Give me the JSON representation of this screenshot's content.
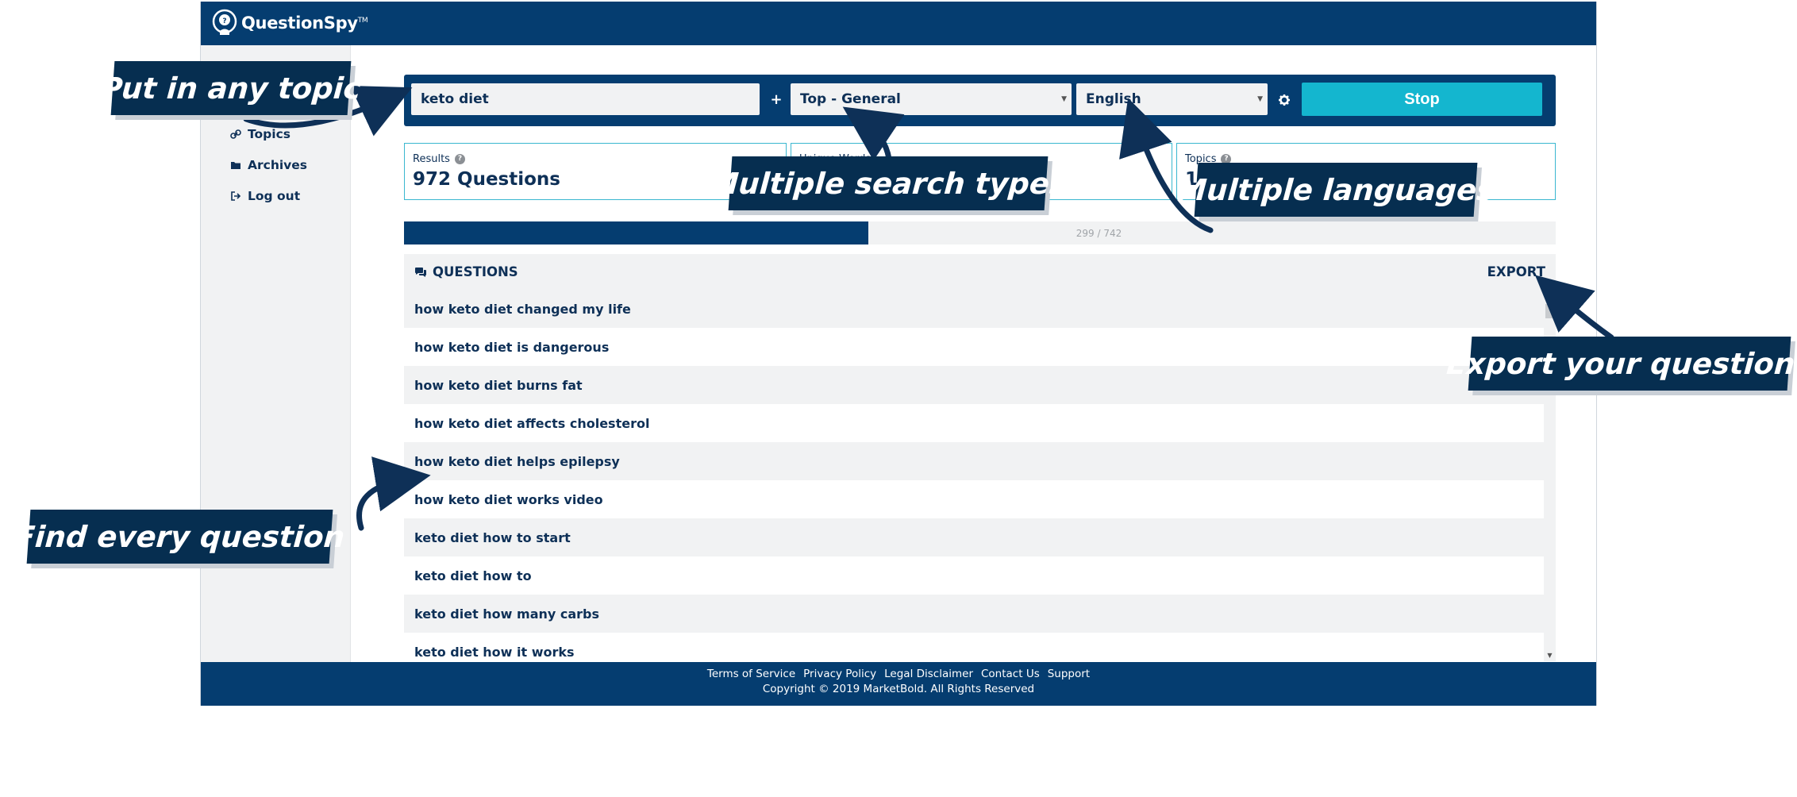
{
  "app": {
    "brand": "QuestionSpy",
    "trademark": "TM"
  },
  "sidebar": {
    "items": [
      {
        "label": "Topics",
        "icon": "link-icon"
      },
      {
        "label": "Archives",
        "icon": "folder-icon"
      },
      {
        "label": "Log out",
        "icon": "logout-icon"
      }
    ]
  },
  "search": {
    "topic_value": "keto diet",
    "plus": "+",
    "search_type": "Top - General",
    "language": "English",
    "stop_label": "Stop"
  },
  "stats": {
    "results_label": "Results",
    "results_value": "972 Questions",
    "unique_label": "Unique Words",
    "unique_value": "",
    "topics_label": "Topics",
    "topics_value": "11"
  },
  "progress": {
    "text": "299 / 742",
    "done": 299,
    "total": 742
  },
  "questions": {
    "title": "QUESTIONS",
    "export_label": "EXPORT",
    "items": [
      "how keto diet changed my life",
      "how keto diet is dangerous",
      "how keto diet burns fat",
      "how keto diet affects cholesterol",
      "how keto diet helps epilepsy",
      "how keto diet works video",
      "keto diet how to start",
      "keto diet how to",
      "keto diet how many carbs",
      "keto diet how it works"
    ]
  },
  "footer": {
    "links": [
      "Terms of Service",
      "Privacy Policy",
      "Legal Disclaimer",
      "Contact Us",
      "Support"
    ],
    "copyright": "Copyright © 2019 MarketBold. All Rights Reserved"
  },
  "callouts": {
    "topic": "Put in any topic",
    "types": "Multiple search types",
    "languages": "Multiple languages",
    "export": "Export your questions",
    "every": "Find every question"
  },
  "colors": {
    "navy": "#053d70",
    "cyan": "#14b6cf",
    "light_gray": "#f1f2f3",
    "callout": "#062e50"
  }
}
